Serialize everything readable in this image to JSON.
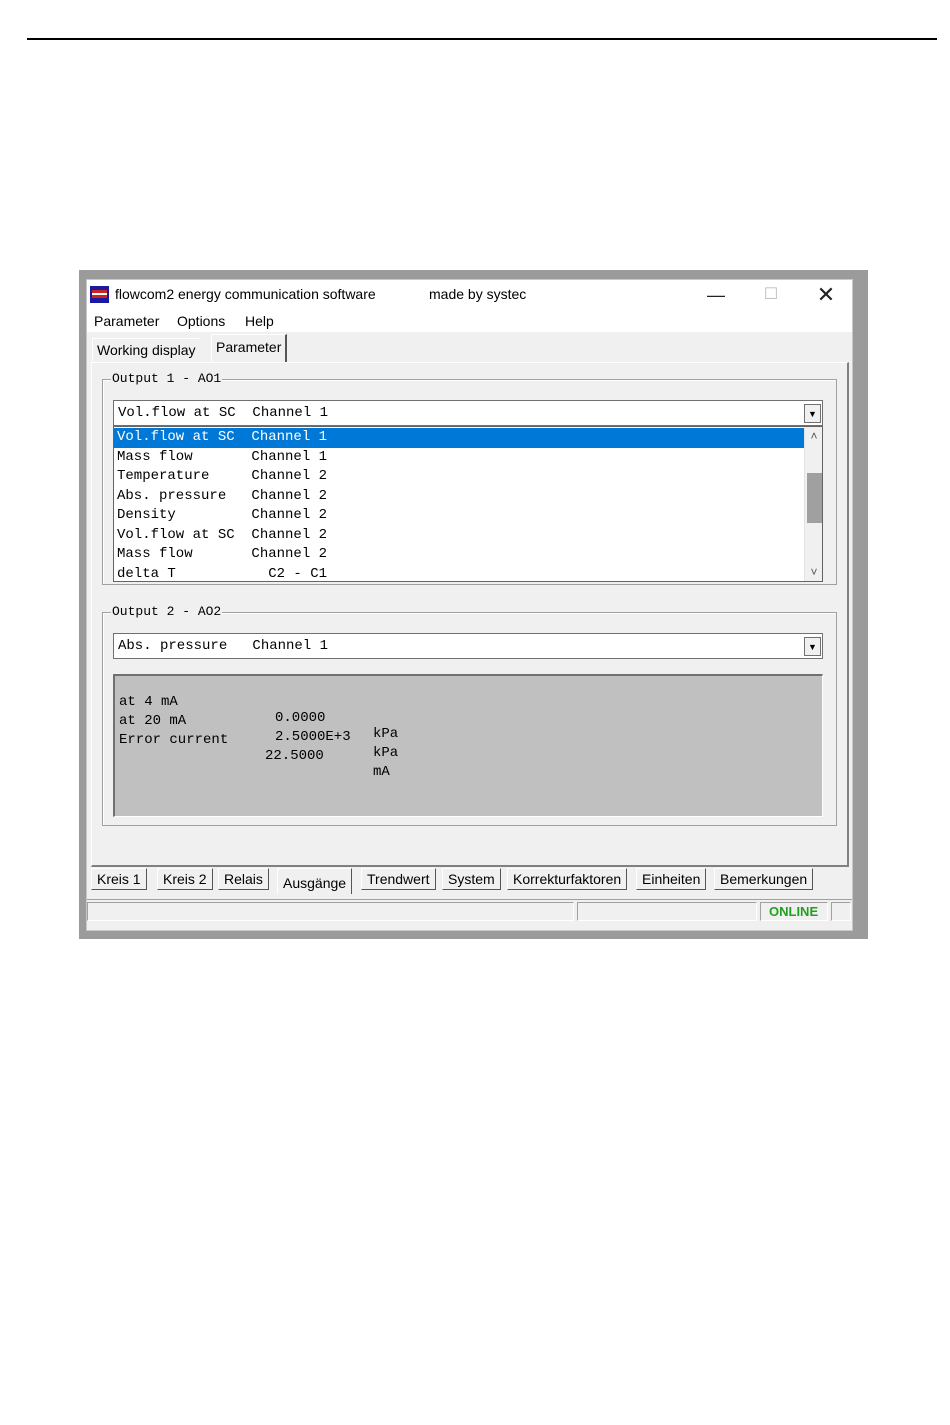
{
  "window": {
    "title": "flowcom2 energy communication software",
    "made_by": "made by systec",
    "buttons": {
      "minimize": "—",
      "maximize": "☐",
      "close": "✕"
    }
  },
  "menu": [
    "Parameter",
    "Options",
    "Help"
  ],
  "top_tabs": [
    {
      "label": "Working display",
      "active": false
    },
    {
      "label": "Parameter",
      "active": true
    }
  ],
  "output1": {
    "title": "Output 1 - AO1",
    "selected": "Vol.flow at SC  Channel 1",
    "options": [
      "Vol.flow at SC  Channel 1",
      "Mass flow       Channel 1",
      "Temperature     Channel 2",
      "Abs. pressure   Channel 2",
      "Density         Channel 2",
      "Vol.flow at SC  Channel 2",
      "Mass flow       Channel 2",
      "delta T           C2 - C1"
    ]
  },
  "output2": {
    "title": "Output 2 - AO2",
    "selected": "Abs. pressure   Channel 1",
    "rows": [
      {
        "label": "at 4 mA",
        "value": "0.0000",
        "unit": "kPa"
      },
      {
        "label": "at 20 mA",
        "value": "2.5000E+3",
        "unit": "kPa"
      },
      {
        "label": "Error current",
        "value": "22.5000",
        "unit": "mA"
      }
    ]
  },
  "bottom_tabs": [
    {
      "label": "Kreis 1",
      "active": false
    },
    {
      "label": "Kreis 2",
      "active": false
    },
    {
      "label": "Relais",
      "active": false
    },
    {
      "label": "Ausgänge",
      "active": true
    },
    {
      "label": "Trendwert",
      "active": false
    },
    {
      "label": "System",
      "active": false
    },
    {
      "label": "Korrekturfaktoren",
      "active": false
    },
    {
      "label": "Einheiten",
      "active": false
    },
    {
      "label": "Bemerkungen",
      "active": false
    }
  ],
  "status": {
    "connection": "ONLINE",
    "connection_color": "#20a020"
  }
}
